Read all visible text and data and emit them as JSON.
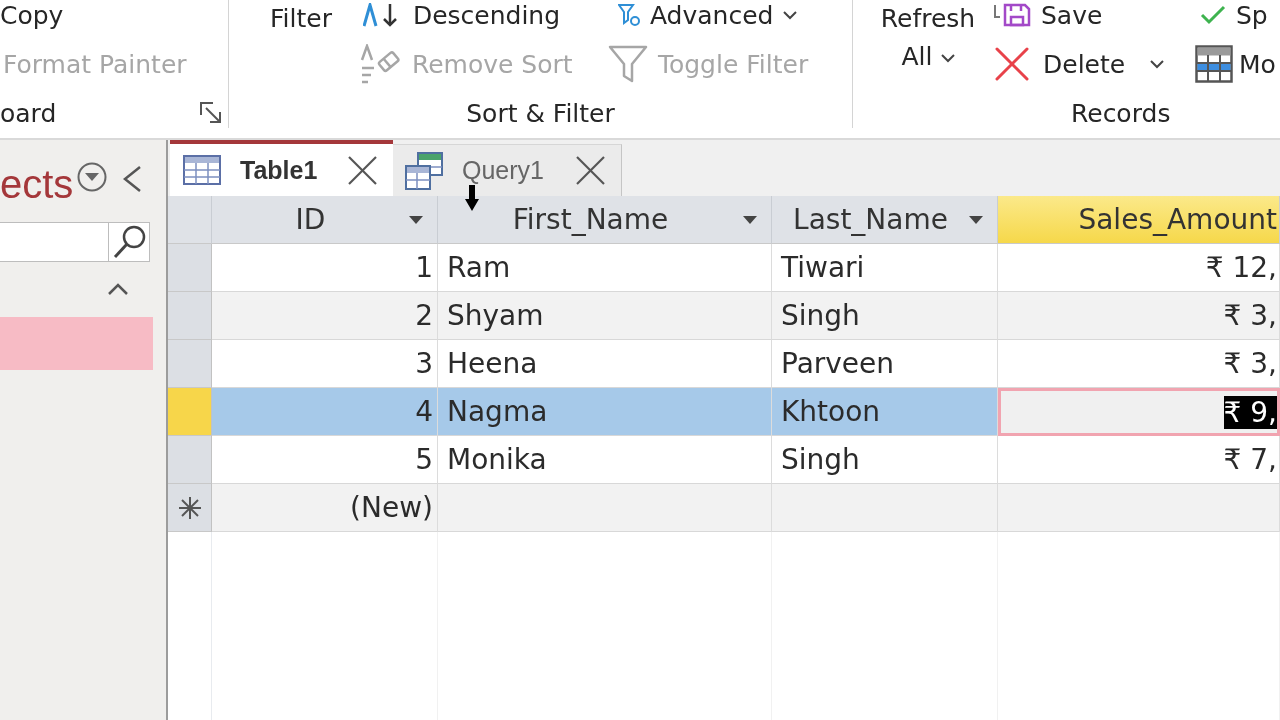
{
  "ribbon": {
    "clipboard": {
      "copy": {
        "label": "Copy",
        "disabled": false
      },
      "format_painter": {
        "label": "Format Painter",
        "disabled": true
      },
      "group_label": "oard"
    },
    "sort_filter": {
      "filter": {
        "label": "Filter",
        "disabled": false
      },
      "descending": {
        "label": "Descending",
        "disabled": false
      },
      "remove_sort": {
        "label": "Remove Sort",
        "disabled": true
      },
      "advanced": {
        "label": "Advanced",
        "disabled": false
      },
      "toggle_filter": {
        "label": "Toggle Filter",
        "disabled": true
      },
      "group_label": "Sort & Filter"
    },
    "records": {
      "refresh_all": {
        "label": "Refresh All",
        "disabled": false
      },
      "save": {
        "label": "Save",
        "disabled": false
      },
      "delete": {
        "label": "Delete",
        "disabled": false
      },
      "command_3": {
        "label": "Sp",
        "disabled": false
      },
      "command_4": {
        "label": "Mo",
        "disabled": false
      },
      "group_label": "Records"
    }
  },
  "nav_pane": {
    "title": "ects",
    "items": [
      {
        "selected": true
      }
    ]
  },
  "tabs": [
    {
      "label": "Table1",
      "kind": "table",
      "selected": true
    },
    {
      "label": "Query1",
      "kind": "query",
      "selected": false
    }
  ],
  "datasheet": {
    "columns": [
      {
        "label": "ID",
        "kind": "number",
        "current": false
      },
      {
        "label": "First_Name",
        "kind": "text",
        "current": false
      },
      {
        "label": "Last_Name",
        "kind": "text",
        "current": false
      },
      {
        "label": "Sales_Amount",
        "kind": "currency",
        "current": true
      }
    ],
    "rows": [
      {
        "kind": "record",
        "selected": false,
        "cells": [
          "1",
          "Ram",
          "Tiwari",
          "₹ 12,"
        ]
      },
      {
        "kind": "record",
        "selected": false,
        "cells": [
          "2",
          "Shyam",
          "Singh",
          "₹ 3,"
        ]
      },
      {
        "kind": "record",
        "selected": false,
        "cells": [
          "3",
          "Heena",
          "Parveen",
          "₹ 3,"
        ]
      },
      {
        "kind": "record",
        "selected": true,
        "cells": [
          "4",
          "Nagma",
          "Khtoon",
          "₹ 9,"
        ]
      },
      {
        "kind": "record",
        "selected": false,
        "cells": [
          "5",
          "Monika",
          "Singh",
          "₹ 7,"
        ]
      },
      {
        "kind": "new",
        "selected": false,
        "cells": [
          "(New)"
        ]
      }
    ]
  }
}
